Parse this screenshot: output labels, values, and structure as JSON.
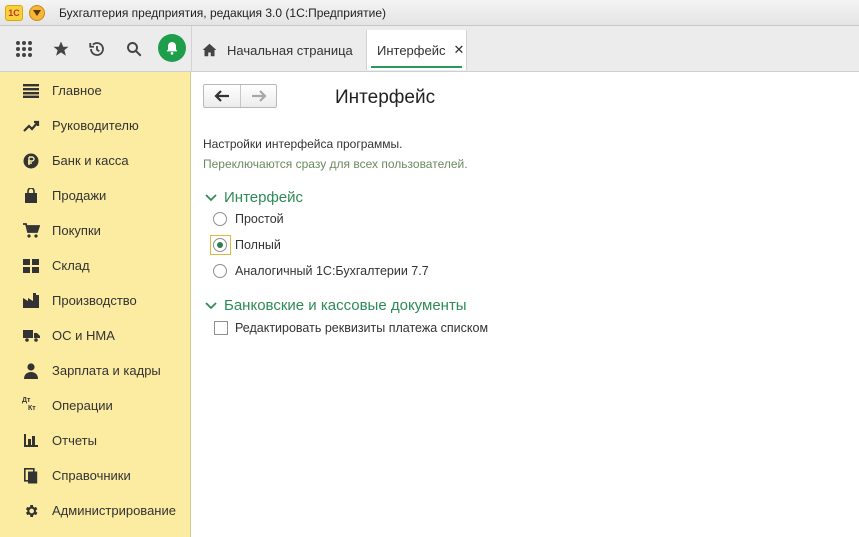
{
  "window": {
    "logo_text": "1С",
    "title": "Бухгалтерия предприятия, редакция 3.0  (1С:Предприятие)"
  },
  "toolbar": {
    "icons": [
      "apps-grid-icon",
      "favorites-star-icon",
      "history-icon",
      "search-icon",
      "notifications-bell-icon"
    ]
  },
  "tabs": {
    "home_label": "Начальная страница",
    "active_label": "Интерфейс",
    "close_glyph": "✕"
  },
  "sidebar": {
    "items": [
      {
        "label": "Главное",
        "icon": "menu-lines-icon"
      },
      {
        "label": "Руководителю",
        "icon": "trend-chart-icon"
      },
      {
        "label": "Банк и касса",
        "icon": "ruble-coin-icon"
      },
      {
        "label": "Продажи",
        "icon": "shopping-bag-icon"
      },
      {
        "label": "Покупки",
        "icon": "cart-icon"
      },
      {
        "label": "Склад",
        "icon": "warehouse-grid-icon"
      },
      {
        "label": "Производство",
        "icon": "factory-icon"
      },
      {
        "label": "ОС и НМА",
        "icon": "truck-icon"
      },
      {
        "label": "Зарплата и кадры",
        "icon": "person-icon"
      },
      {
        "label": "Операции",
        "icon": "debit-credit-icon"
      },
      {
        "label": "Отчеты",
        "icon": "bar-chart-icon"
      },
      {
        "label": "Справочники",
        "icon": "books-icon"
      },
      {
        "label": "Администрирование",
        "icon": "gear-icon"
      }
    ],
    "dtkt_glyph_top": "Дт",
    "dtkt_glyph_bottom": "Кт"
  },
  "main": {
    "title": "Интерфейс",
    "description": "Настройки интерфейса программы.",
    "note": "Переключаются сразу для всех пользователей.",
    "interface_group": {
      "title": "Интерфейс",
      "options": [
        {
          "label": "Простой",
          "selected": false
        },
        {
          "label": "Полный",
          "selected": true
        },
        {
          "label": "Аналогичный 1С:Бухгалтерии 7.7",
          "selected": false
        }
      ]
    },
    "bank_group": {
      "title": "Банковские и кассовые документы",
      "checkbox_label": "Редактировать реквизиты платежа списком",
      "checked": false
    }
  },
  "colors": {
    "sidebar_bg": "#fbeca2",
    "accent_green": "#2e8b57",
    "bell_green": "#1e9e4a",
    "note_text": "#6b8a5e"
  }
}
